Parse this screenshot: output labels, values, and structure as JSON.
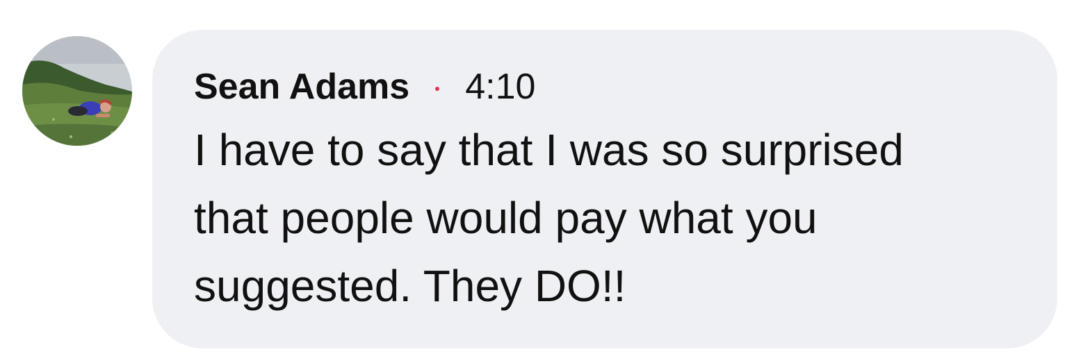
{
  "comment": {
    "author": "Sean Adams",
    "separator": "·",
    "timestamp": "4:10",
    "text": "I have to say that I was so surprised that people would pay what you suggested. They DO!!",
    "avatar_icon": "profile-photo-avatar"
  },
  "colors": {
    "bubble_background": "#eef0f3",
    "text": "#111111",
    "separator_dot": "#e8344e"
  }
}
